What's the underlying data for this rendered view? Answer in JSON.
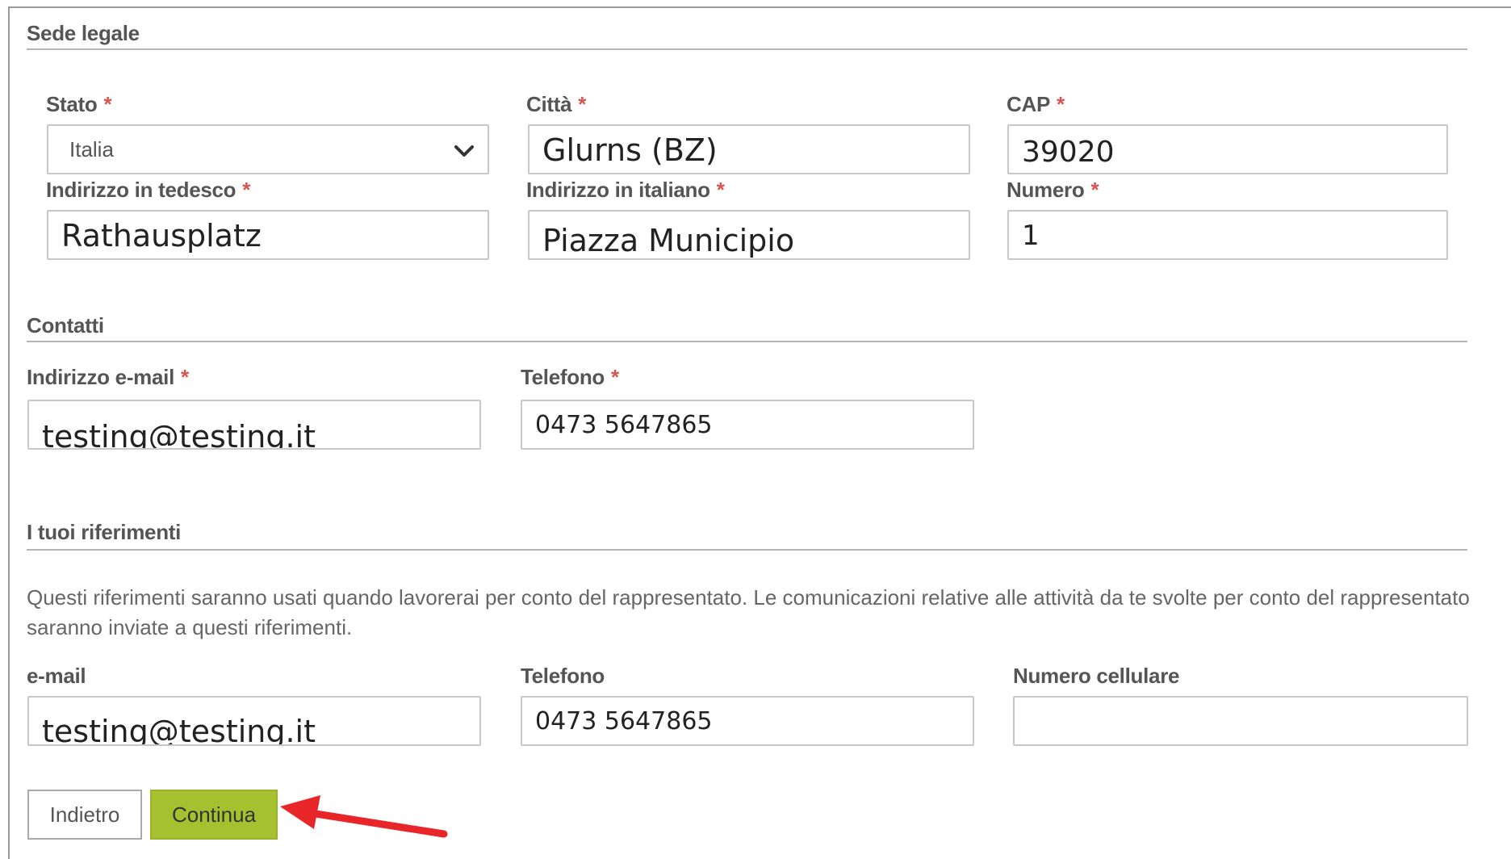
{
  "sede_legale": {
    "title": "Sede legale",
    "stato": {
      "label": "Stato",
      "value": "Italia"
    },
    "citta": {
      "label": "Città",
      "value": "Glurns (BZ)"
    },
    "cap": {
      "label": "CAP",
      "value": "39020"
    },
    "indirizzo_tedesco": {
      "label": "Indirizzo in tedesco",
      "value": "Rathausplatz"
    },
    "indirizzo_italiano": {
      "label": "Indirizzo in italiano",
      "value": "Piazza Municipio"
    },
    "numero": {
      "label": "Numero",
      "value": "1"
    }
  },
  "contatti": {
    "title": "Contatti",
    "email": {
      "label": "Indirizzo e-mail",
      "value": "testing@testing.it"
    },
    "telefono": {
      "label": "Telefono",
      "value": "0473 5647865"
    }
  },
  "riferimenti": {
    "title": "I tuoi riferimenti",
    "description": "Questi riferimenti saranno usati quando lavorerai per conto del rappresentato. Le comunicazioni relative alle attività da te svolte per conto del rappresentato saranno inviate a questi riferimenti.",
    "email": {
      "label": "e-mail",
      "value": "testing@testing.it"
    },
    "telefono": {
      "label": "Telefono",
      "value": "0473 5647865"
    },
    "cellulare": {
      "label": "Numero cellulare",
      "value": ""
    }
  },
  "required_marker": "*",
  "buttons": {
    "back": "Indietro",
    "continue": "Continua"
  },
  "colors": {
    "accent_button": "#a6c12f",
    "required": "#d9534f",
    "annotation_arrow": "#e8262a"
  },
  "icons": {
    "select_chevron": "chevron-down-icon",
    "annotation": "red-arrow-icon"
  }
}
